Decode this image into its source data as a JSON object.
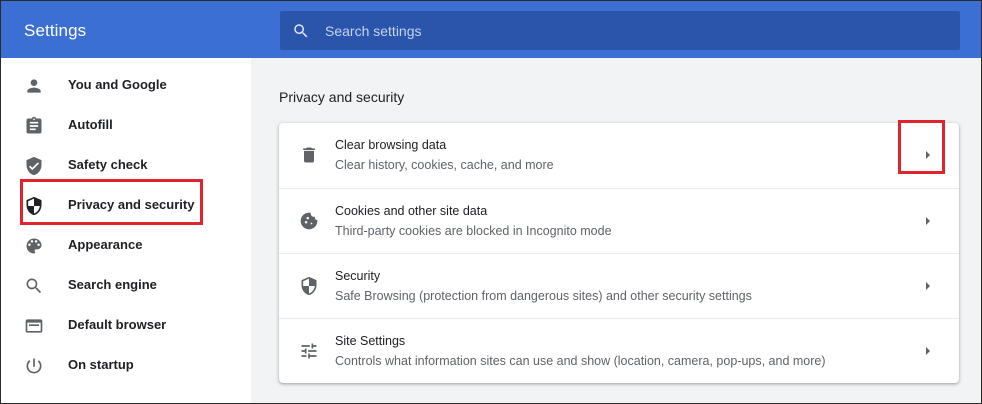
{
  "header": {
    "title": "Settings",
    "search_placeholder": "Search settings",
    "search_value": ""
  },
  "sidebar": {
    "items": [
      {
        "label": "You and Google",
        "icon": "person-icon"
      },
      {
        "label": "Autofill",
        "icon": "clipboard-icon"
      },
      {
        "label": "Safety check",
        "icon": "shield-check-icon"
      },
      {
        "label": "Privacy and security",
        "icon": "shield-half-icon",
        "highlighted": true
      },
      {
        "label": "Appearance",
        "icon": "palette-icon"
      },
      {
        "label": "Search engine",
        "icon": "search-icon"
      },
      {
        "label": "Default browser",
        "icon": "browser-window-icon"
      },
      {
        "label": "On startup",
        "icon": "power-icon"
      }
    ]
  },
  "main": {
    "section_title": "Privacy and security",
    "rows": [
      {
        "title": "Clear browsing data",
        "subtitle": "Clear history, cookies, cache, and more",
        "icon": "trash-icon"
      },
      {
        "title": "Cookies and other site data",
        "subtitle": "Third-party cookies are blocked in Incognito mode",
        "icon": "cookie-icon"
      },
      {
        "title": "Security",
        "subtitle": "Safe Browsing (protection from dangerous sites) and other security settings",
        "icon": "shield-half-icon"
      },
      {
        "title": "Site Settings",
        "subtitle": "Controls what information sites can use and show (location, camera, pop-ups, and more)",
        "icon": "sliders-icon"
      }
    ]
  },
  "colors": {
    "header_bg": "#3b6fd4",
    "search_bg": "#2a55ab",
    "main_bg": "#f1f3f4",
    "highlight": "#e0242e",
    "icon": "#5f6368"
  }
}
